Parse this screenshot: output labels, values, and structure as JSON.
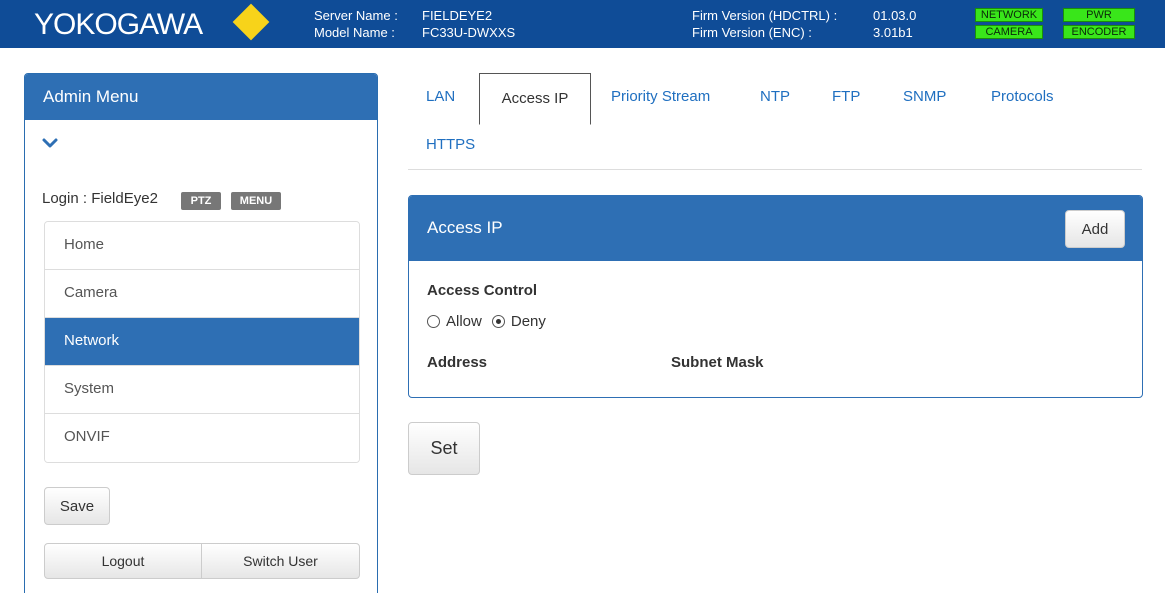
{
  "header": {
    "brand": "YOKOGAWA",
    "server_name_label": "Server Name :",
    "server_name_value": "FIELDEYE2",
    "model_name_label": "Model Name :",
    "model_name_value": "FC33U-DWXXS",
    "firm_hdctrl_label": "Firm Version (HDCTRL) :",
    "firm_hdctrl_value": "01.03.0",
    "firm_enc_label": "Firm Version (ENC) :",
    "firm_enc_value": "3.01b1",
    "status_indicators": [
      "NETWORK",
      "PWR",
      "CAMERA",
      "ENCODER"
    ],
    "status_color": "#39e61a",
    "brand_color": "#0f4c97"
  },
  "sidebar": {
    "title": "Admin Menu",
    "login_text": "Login : FieldEye2",
    "badges": [
      "PTZ",
      "MENU"
    ],
    "items": [
      {
        "label": "Home",
        "active": false
      },
      {
        "label": "Camera",
        "active": false
      },
      {
        "label": "Network",
        "active": true
      },
      {
        "label": "System",
        "active": false
      },
      {
        "label": "ONVIF",
        "active": false
      }
    ],
    "save_label": "Save",
    "logout_label": "Logout",
    "switch_user_label": "Switch User"
  },
  "tabs": [
    {
      "label": "LAN",
      "active": false
    },
    {
      "label": "Access IP",
      "active": true
    },
    {
      "label": "Priority Stream",
      "active": false
    },
    {
      "label": "NTP",
      "active": false
    },
    {
      "label": "FTP",
      "active": false
    },
    {
      "label": "SNMP",
      "active": false
    },
    {
      "label": "Protocols",
      "active": false
    },
    {
      "label": "HTTPS",
      "active": false
    }
  ],
  "panel": {
    "title": "Access IP",
    "add_label": "Add",
    "access_control_label": "Access Control",
    "allow_label": "Allow",
    "deny_label": "Deny",
    "selected": "Deny",
    "address_header": "Address",
    "subnet_header": "Subnet Mask"
  },
  "set_label": "Set"
}
